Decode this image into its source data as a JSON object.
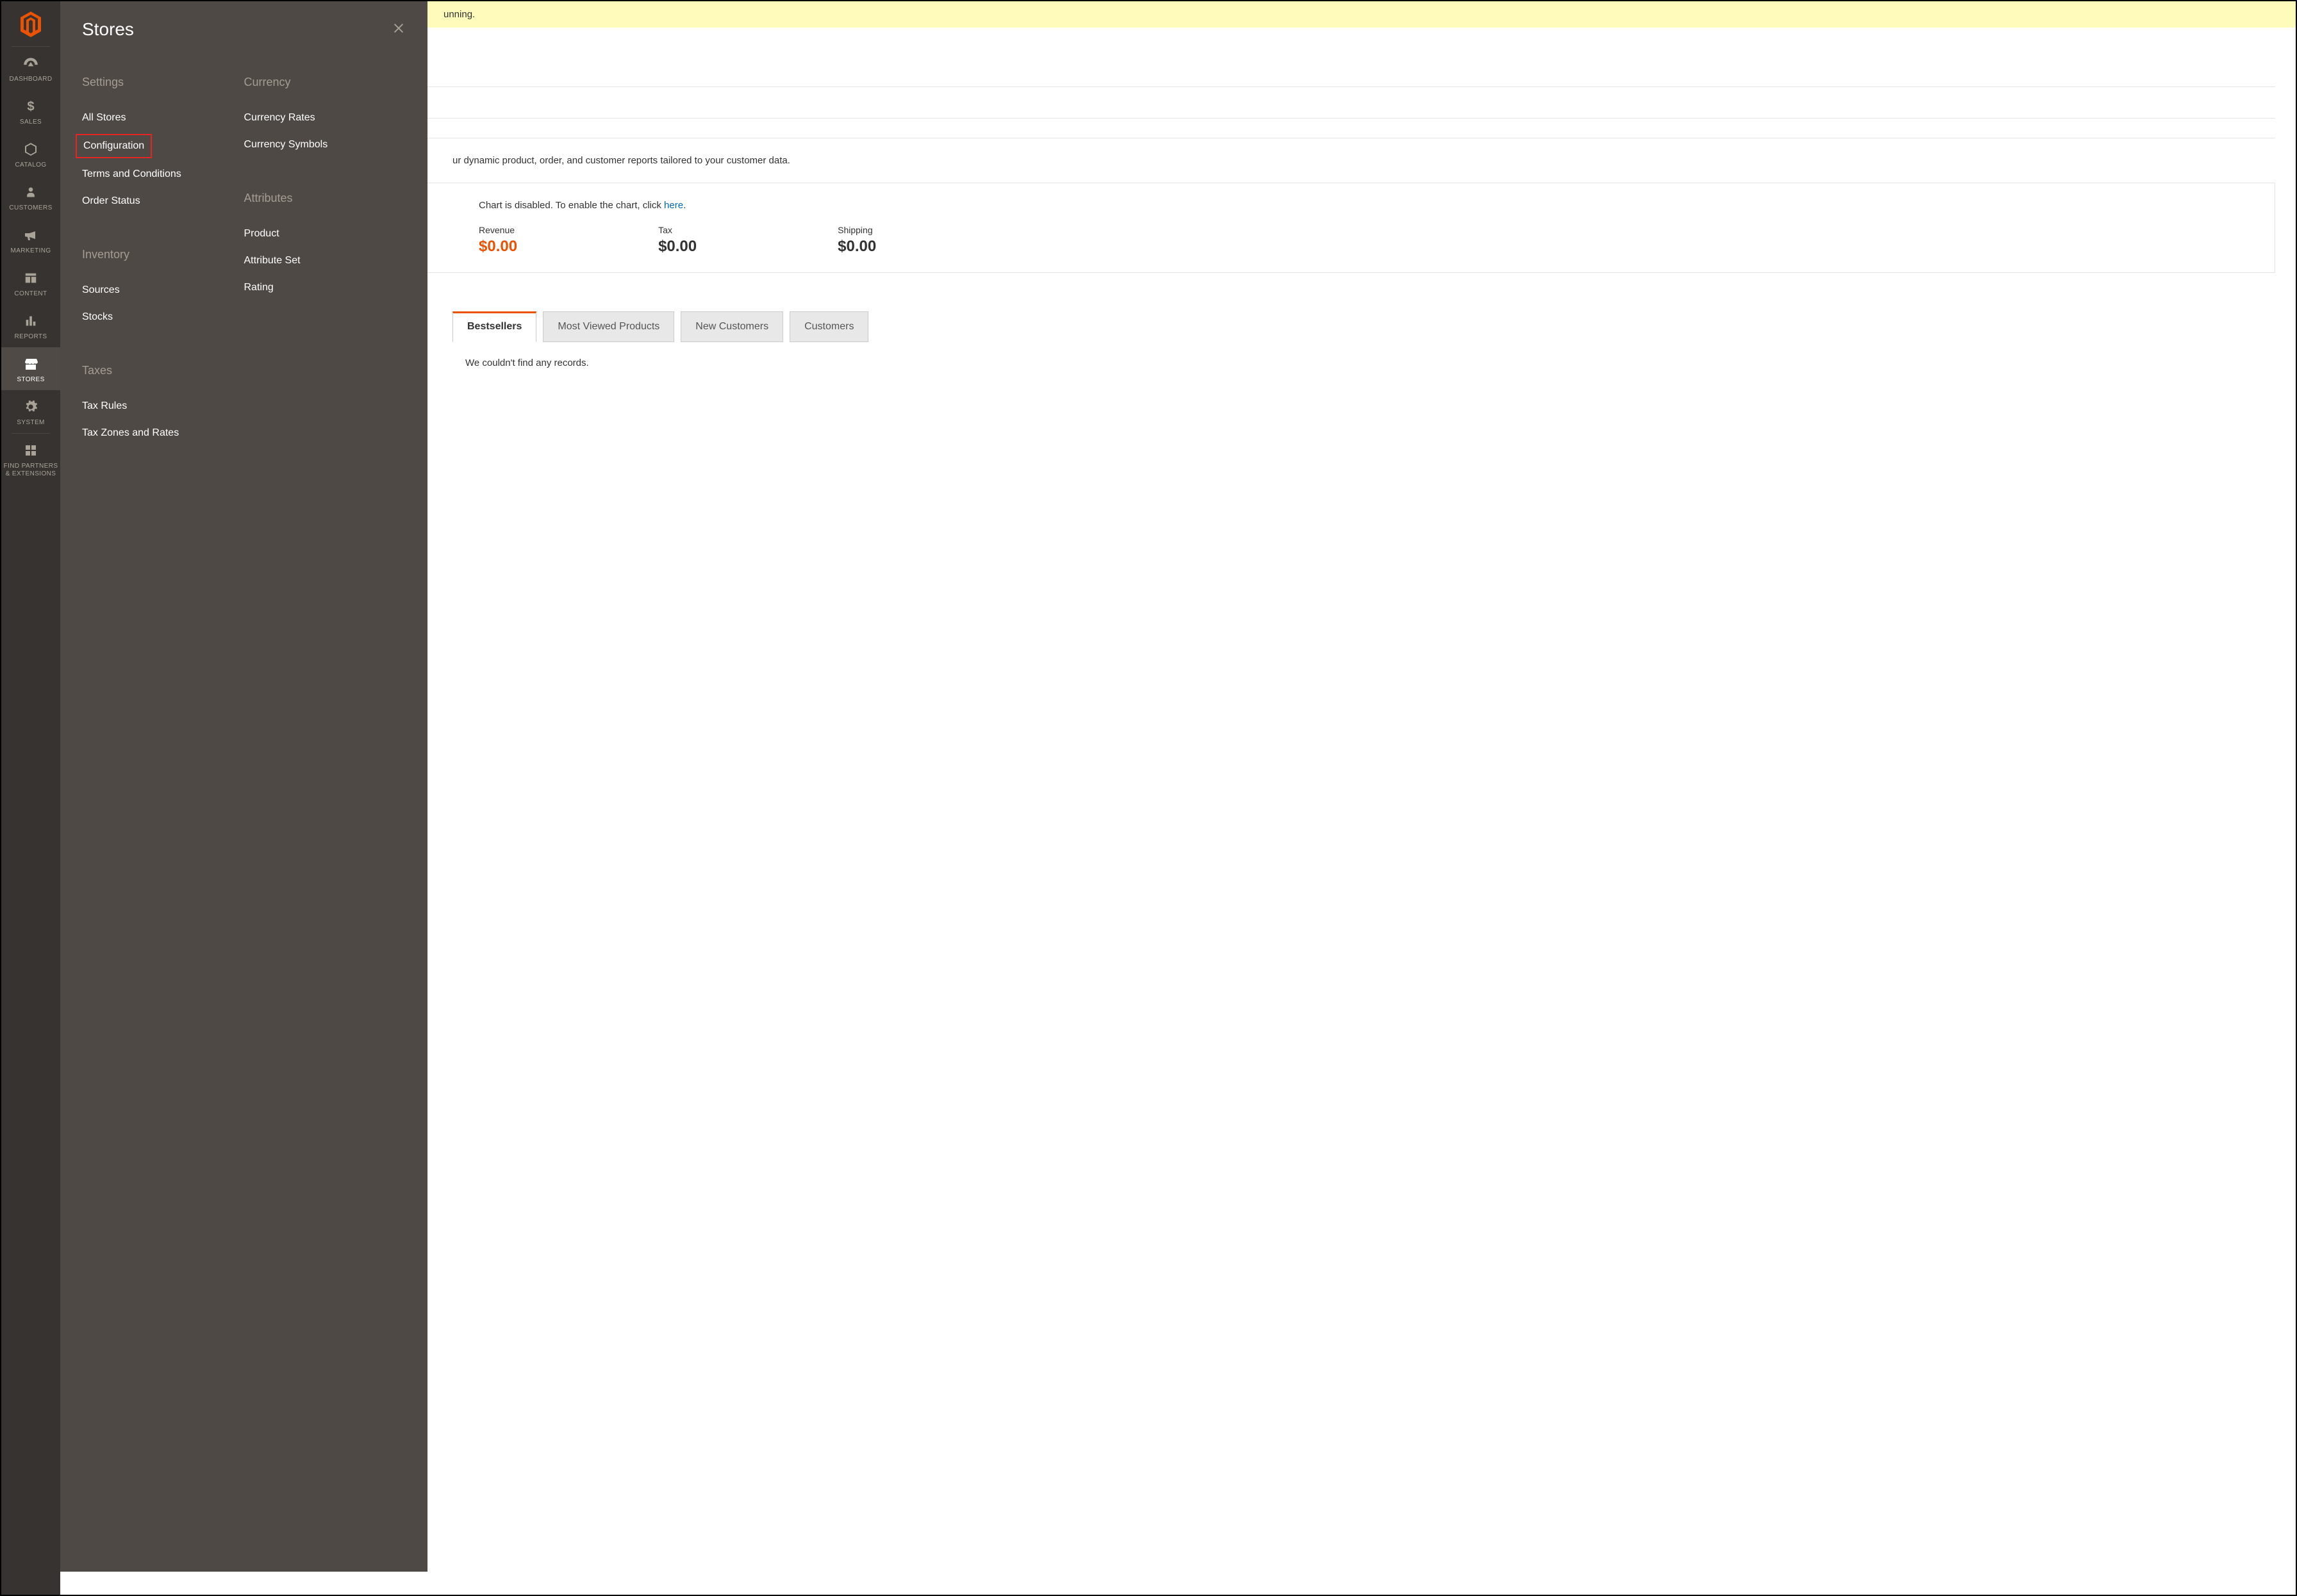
{
  "sidebar": {
    "items": [
      {
        "key": "dashboard",
        "label": "DASHBOARD",
        "icon": "gauge"
      },
      {
        "key": "sales",
        "label": "SALES",
        "icon": "dollar"
      },
      {
        "key": "catalog",
        "label": "CATALOG",
        "icon": "cube"
      },
      {
        "key": "customers",
        "label": "CUSTOMERS",
        "icon": "person"
      },
      {
        "key": "marketing",
        "label": "MARKETING",
        "icon": "megaphone"
      },
      {
        "key": "content",
        "label": "CONTENT",
        "icon": "layout"
      },
      {
        "key": "reports",
        "label": "REPORTS",
        "icon": "bars"
      },
      {
        "key": "stores",
        "label": "STORES",
        "icon": "store",
        "active": true
      },
      {
        "key": "system",
        "label": "SYSTEM",
        "icon": "gear"
      },
      {
        "key": "partners",
        "label": "FIND PARTNERS\n& EXTENSIONS",
        "icon": "blocks"
      }
    ]
  },
  "flyout": {
    "title": "Stores",
    "columns": [
      {
        "groups": [
          {
            "title": "Settings",
            "links": [
              "All Stores",
              "Configuration",
              "Terms and Conditions",
              "Order Status"
            ],
            "highlight": "Configuration"
          },
          {
            "title": "Inventory",
            "links": [
              "Sources",
              "Stocks"
            ]
          },
          {
            "title": "Taxes",
            "links": [
              "Tax Rules",
              "Tax Zones and Rates"
            ]
          }
        ]
      },
      {
        "groups": [
          {
            "title": "Currency",
            "links": [
              "Currency Rates",
              "Currency Symbols"
            ]
          },
          {
            "title": "Attributes",
            "links": [
              "Product",
              "Attribute Set",
              "Rating"
            ]
          }
        ]
      }
    ]
  },
  "banner": {
    "text_fragment": "unning."
  },
  "dashboard": {
    "advanced_text_fragment": "ur dynamic product, order, and customer reports tailored to your customer data.",
    "chart_disabled_prefix": "Chart is disabled. To enable the chart, click ",
    "chart_disabled_link": "here",
    "chart_disabled_suffix": ".",
    "stats": [
      {
        "label": "Revenue",
        "value": "$0.00",
        "emph": true
      },
      {
        "label": "Tax",
        "value": "$0.00"
      },
      {
        "label": "Shipping",
        "value": "$0.00"
      }
    ],
    "tabs": [
      "Bestsellers",
      "Most Viewed Products",
      "New Customers",
      "Customers"
    ],
    "active_tab": "Bestsellers",
    "no_records": "We couldn't find any records."
  }
}
